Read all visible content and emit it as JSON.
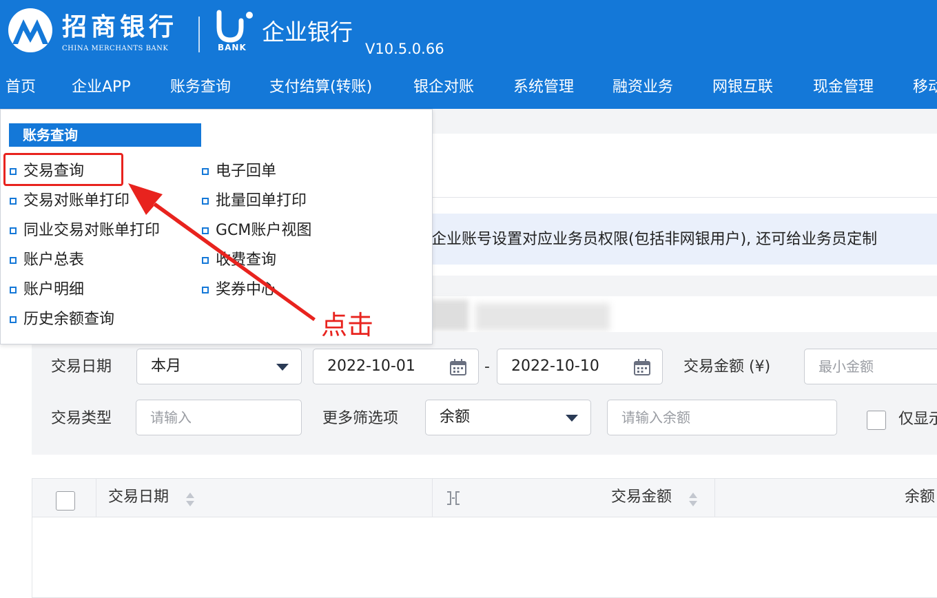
{
  "header": {
    "bank_name_cn": "招商银行",
    "bank_name_en": "CHINA MERCHANTS BANK",
    "ubank_label": "BANK",
    "product_title": "企业银行",
    "version": "V10.5.0.66"
  },
  "nav": {
    "items": [
      {
        "label": "首页"
      },
      {
        "label": "企业APP"
      },
      {
        "label": "账务查询"
      },
      {
        "label": "支付结算(转账)"
      },
      {
        "label": "银企对账"
      },
      {
        "label": "系统管理"
      },
      {
        "label": "融资业务"
      },
      {
        "label": "网银互联"
      },
      {
        "label": "现金管理"
      },
      {
        "label": "移动"
      }
    ]
  },
  "dropdown": {
    "title": "账务查询",
    "left_items": [
      {
        "label": "交易查询"
      },
      {
        "label": "交易对账单打印"
      },
      {
        "label": "同业交易对账单打印"
      },
      {
        "label": "账户总表"
      },
      {
        "label": "账户明细"
      },
      {
        "label": "历史余额查询"
      }
    ],
    "right_items": [
      {
        "label": "电子回单"
      },
      {
        "label": "批量回单打印"
      },
      {
        "label": "GCM账户视图"
      },
      {
        "label": "收费查询"
      },
      {
        "label": "奖券中心"
      }
    ]
  },
  "annotation": {
    "text": "点击",
    "color": "#e8231e"
  },
  "notice": {
    "text": "企业账号设置对应业务员权限(包括非网银用户), 还可给业务员定制"
  },
  "filters": {
    "date_label": "交易日期",
    "date_range_value": "本月",
    "start_date": "2022-10-01",
    "date_separator": "-",
    "end_date": "2022-10-10",
    "amount_label": "交易金额 (¥)",
    "min_amount_placeholder": "最小金额",
    "type_label": "交易类型",
    "type_placeholder": "请输入",
    "more_filters_label": "更多筛选项",
    "more_filters_value": "余额",
    "balance_placeholder": "请输入余额",
    "only_show_label": "仅显示"
  },
  "table": {
    "columns": [
      {
        "label": "交易日期"
      },
      {
        "label": "交易金额"
      },
      {
        "label": "余额"
      }
    ]
  },
  "colors": {
    "brand_blue": "#1478d8",
    "highlight_red": "#e8231e"
  }
}
